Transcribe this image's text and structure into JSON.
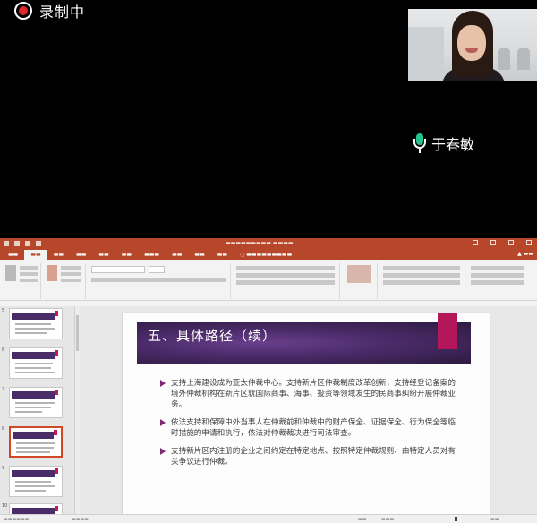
{
  "recording": {
    "label": "录制中",
    "indicator_color": "#e0272b"
  },
  "participant": {
    "name": "于春敏",
    "mic_color": "#22c58b"
  },
  "ppt": {
    "accent_color": "#b7472a",
    "slide": {
      "title": "五、具体路径（续）",
      "title_band_color": "#4a2a68",
      "accent_color": "#b3175a",
      "bullets": [
        "支持上海建设成为亚太仲裁中心。支持新片区仲裁制度改革创新，支持经登记备案的境外仲裁机构在新片区就国际商事、海事、投资等领域发生的民商事纠纷开展仲裁业务。",
        "依法支持和保障中外当事人在仲裁前和仲裁中的财产保全、证据保全、行为保全等临时措施的申请和执行，依法对仲裁裁决进行司法审查。",
        "支持新片区内注册的企业之间约定在特定地点、按照特定仲裁规则、由特定人员对有关争议进行仲裁。"
      ]
    },
    "thumbnails": [
      {
        "number": "5"
      },
      {
        "number": "6"
      },
      {
        "number": "7"
      },
      {
        "number": "8",
        "selected": true
      },
      {
        "number": "9"
      },
      {
        "number": "10"
      }
    ]
  }
}
